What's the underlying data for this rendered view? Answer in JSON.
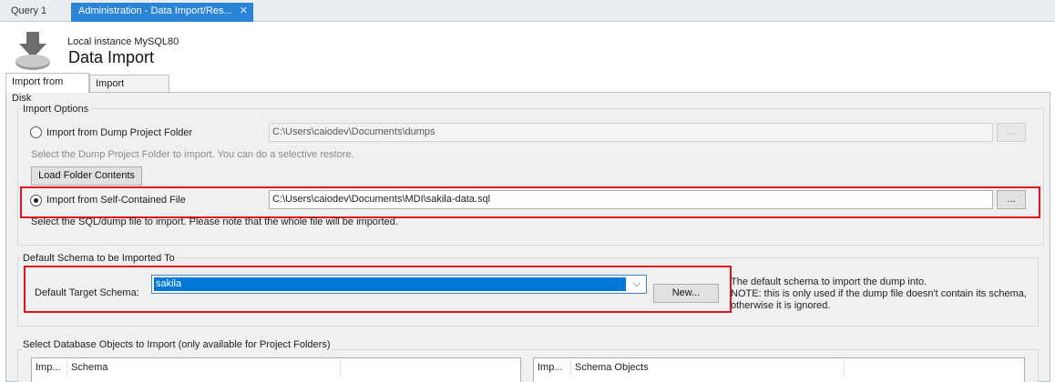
{
  "tabs": [
    {
      "label": "Query 1"
    },
    {
      "label": "Administration - Data Import/Res..."
    }
  ],
  "header": {
    "subtitle": "Local instance MySQL80",
    "title": "Data Import"
  },
  "inner_tabs": [
    {
      "label": "Import from Disk"
    },
    {
      "label": "Import Progress"
    }
  ],
  "import_options": {
    "group_label": "Import Options",
    "dump_folder_label": "Import from Dump Project Folder",
    "dump_folder_path": "C:\\Users\\caiodev\\Documents\\dumps",
    "browse_label": "...",
    "dump_folder_hint": "Select the Dump Project Folder to import. You can do a selective restore.",
    "load_folder_label": "Load Folder Contents",
    "self_contained_label": "Import from Self-Contained File",
    "self_contained_path": "C:\\Users\\caiodev\\Documents\\MDI\\sakila-data.sql",
    "self_contained_hint": "Select the SQL/dump file to import. Please note that the whole file will be imported.",
    "selected_option": "self_contained"
  },
  "schema": {
    "group_label": "Default Schema to be Imported To",
    "target_label": "Default Target Schema:",
    "selected_schema": "sakila",
    "new_button": "New...",
    "note_line1": "The default schema to import the dump into.",
    "note_line2": "NOTE: this is only used if the dump file doesn't contain its schema,",
    "note_line3": "otherwise it is ignored."
  },
  "objects": {
    "group_label": "Select Database Objects to Import (only available for Project Folders)",
    "left_columns": [
      "Imp...",
      "Schema"
    ],
    "right_columns": [
      "Imp...",
      "Schema Objects"
    ]
  },
  "colors": {
    "accent": "#0078d7",
    "highlight": "#e0141e"
  },
  "close_icon": "close-icon",
  "chevron_icon": "chevron-down-icon"
}
